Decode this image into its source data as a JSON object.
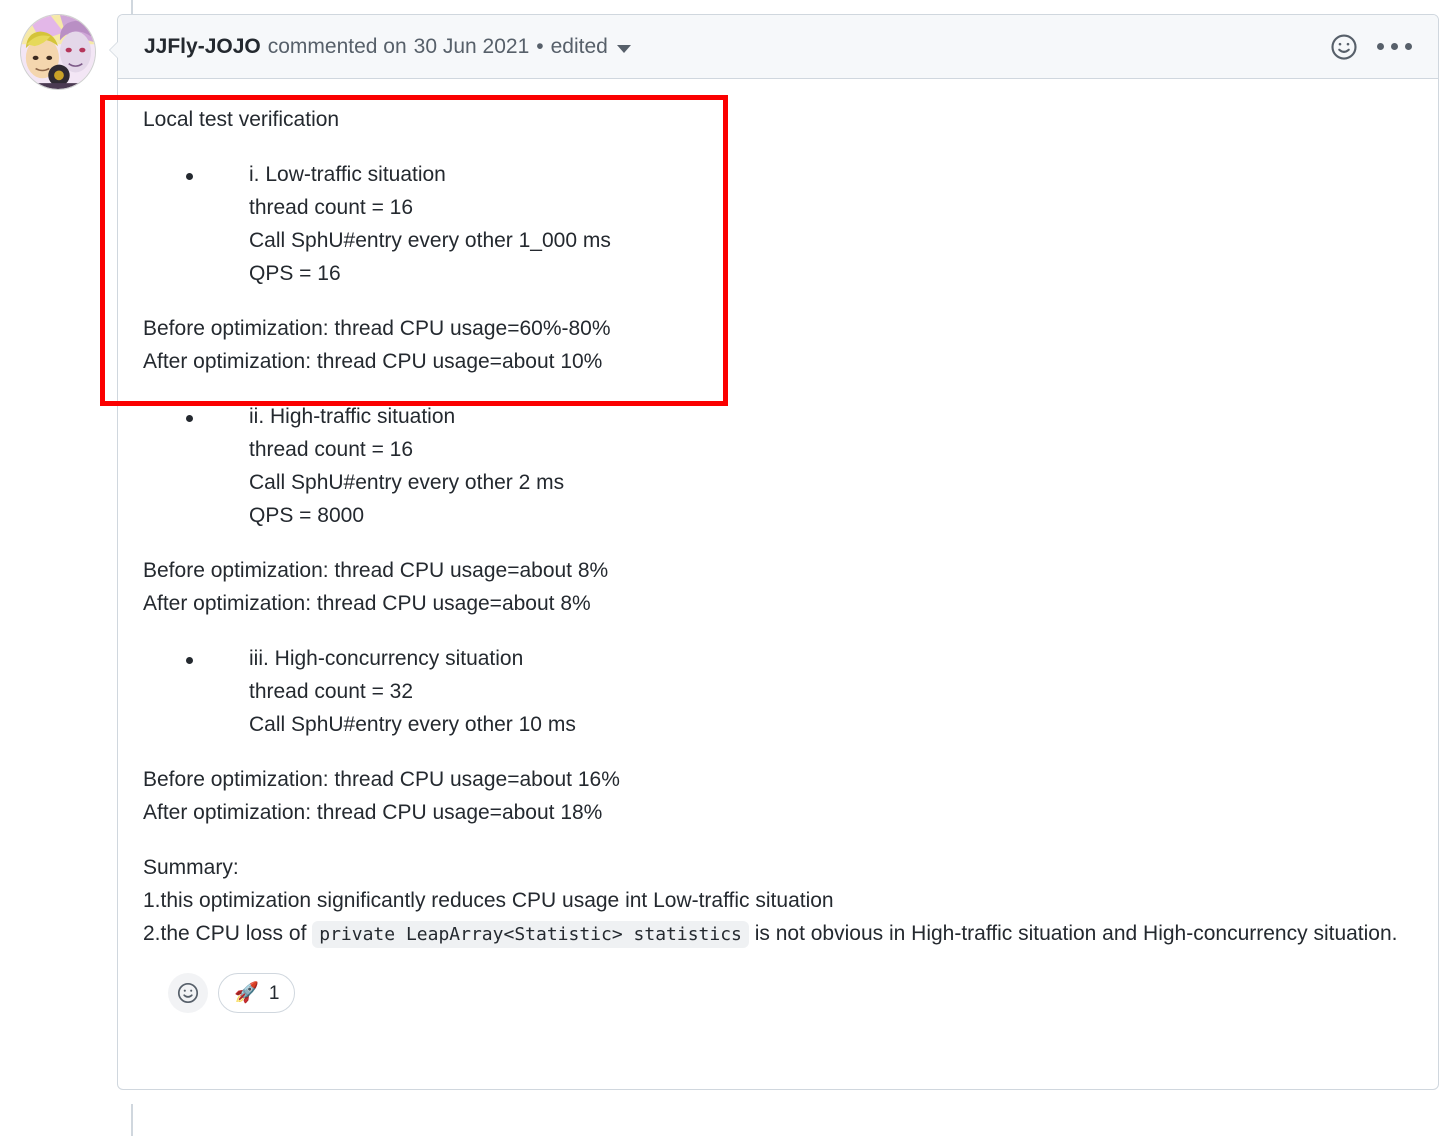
{
  "header": {
    "author": "JJFly-JOJO",
    "commented_text": "commented on",
    "date": "30 Jun 2021",
    "separator": "•",
    "edited_label": "edited",
    "reaction_icon": "smiley-icon",
    "menu_icon": "kebab-menu-icon"
  },
  "body": {
    "intro": "Local test verification",
    "sections": [
      {
        "title": "i. Low-traffic situation",
        "lines": [
          "thread count = 16",
          "Call SphU#entry every other 1_000 ms",
          "QPS = 16"
        ],
        "before": "Before optimization: thread CPU usage=60%-80%",
        "after": "After optimization: thread CPU usage=about 10%"
      },
      {
        "title": "ii. High-traffic situation",
        "lines": [
          "thread count = 16",
          "Call SphU#entry every other 2 ms",
          "QPS = 8000"
        ],
        "before": "Before optimization: thread CPU usage=about 8%",
        "after": "After optimization: thread CPU usage=about 8%"
      },
      {
        "title": "iii. High-concurrency situation",
        "lines": [
          "thread count = 32",
          "Call SphU#entry every other 10 ms"
        ],
        "before": "Before optimization: thread CPU usage=about 16%",
        "after": "After optimization: thread CPU usage=about 18%"
      }
    ],
    "summary": {
      "heading": "Summary:",
      "point1": "1.this optimization significantly reduces CPU usage int Low-traffic situation",
      "point2_prefix": "2.the CPU loss of ",
      "point2_code": "private LeapArray<Statistic> statistics",
      "point2_suffix": " is not obvious in High-traffic situation and High-concurrency situation."
    }
  },
  "reactions": {
    "add_icon": "smiley-add-reaction-icon",
    "items": [
      {
        "emoji": "🚀",
        "name": "rocket-reaction",
        "count": "1"
      }
    ]
  },
  "annotation": {
    "highlight_color": "#fb0000",
    "shape": "rectangle"
  }
}
